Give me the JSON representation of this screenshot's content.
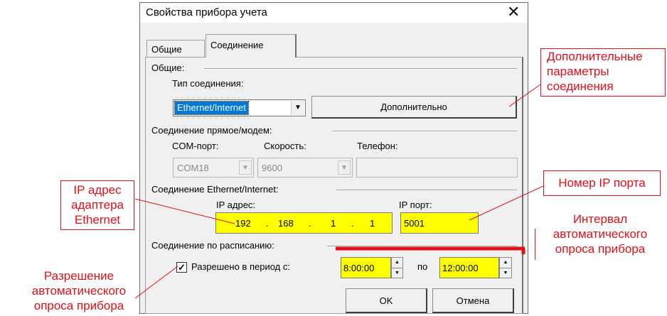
{
  "dialog": {
    "title": "Свойства прибора учета",
    "tabs": [
      {
        "label": "Общие",
        "active": false
      },
      {
        "label": "Соединение",
        "active": true
      }
    ]
  },
  "general_group": {
    "title": "Общие:",
    "connection_type_label": "Тип соединения:",
    "connection_type_value": "Ethernet/Internet",
    "advanced_button": "Дополнительно"
  },
  "direct_group": {
    "title": "Соединение прямое/модем:",
    "com_port_label": "COM-порт:",
    "com_port_value": "COM18",
    "speed_label": "Скорость:",
    "speed_value": "9600",
    "phone_label": "Телефон:",
    "phone_value": ""
  },
  "ethernet_group": {
    "title": "Соединение Ethernet/Internet:",
    "ip_label": "IP адрес:",
    "ip_octets": [
      "192",
      "168",
      "1",
      "1"
    ],
    "port_label": "IP порт:",
    "port_value": "5001"
  },
  "schedule_group": {
    "title": "Соединение по расписанию:",
    "checkbox_label": "Разрешено в период с:",
    "checked": true,
    "from_time": "8:00:00",
    "to_label": "по",
    "to_time": "12:00:00"
  },
  "footer": {
    "ok_button": "OK",
    "cancel_button": "Отмена"
  },
  "annotations": {
    "extra_params": [
      "Дополнительные",
      "параметры",
      "соединения"
    ],
    "ip_port_number": "Номер IP порта",
    "ip_adapter": [
      "IP адрес",
      "адаптера",
      "Ethernet"
    ],
    "interval": [
      "Интервал",
      "автоматического",
      "опроса прибора"
    ],
    "permission": [
      "Разрешение",
      "автоматического",
      "опроса прибора"
    ]
  },
  "colors": {
    "annotation_red": "#e0101a",
    "highlight_yellow": "#ffff00",
    "selection_blue": "#0078d7"
  }
}
